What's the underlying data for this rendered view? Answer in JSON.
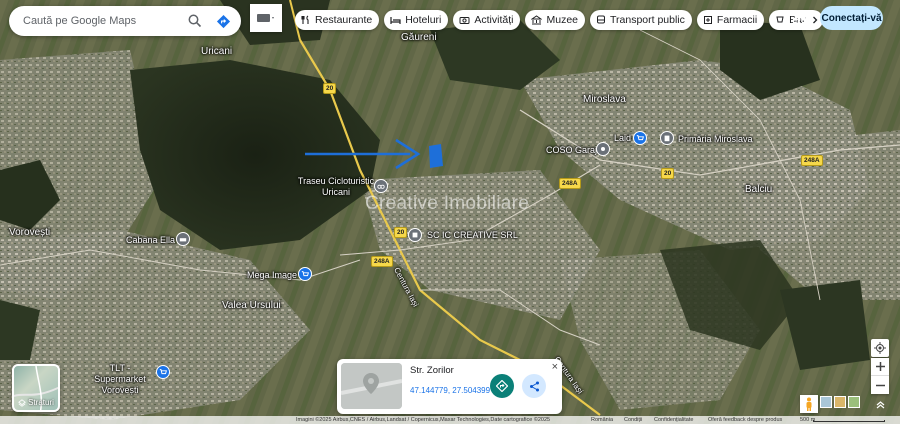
{
  "search": {
    "placeholder": "Caută pe Google Maps"
  },
  "chips": [
    {
      "label": "Restaurante",
      "icon": "fork-knife-icon"
    },
    {
      "label": "Hoteluri",
      "icon": "bed-icon"
    },
    {
      "label": "Activități",
      "icon": "camera-icon"
    },
    {
      "label": "Muzee",
      "icon": "museum-icon"
    },
    {
      "label": "Transport public",
      "icon": "bus-icon"
    },
    {
      "label": "Farmacii",
      "icon": "pharmacy-icon"
    },
    {
      "label": "Bar",
      "icon": "cup-icon"
    }
  ],
  "header": {
    "signin_label": "Conectați-vă"
  },
  "map_labels": {
    "gaureni": "Găureni",
    "uricani": "Uricani",
    "miroslava": "Miroslava",
    "laid": "Laid",
    "primaria": "Primăria Miroslava",
    "coso": "COSO Garaj",
    "traseu": "Traseu Cicloturistic Uricani",
    "balciu": "Balciu",
    "vorovesti": "Vorovești",
    "cabana": "Cabana Ella",
    "sc_creative": "SC IC CREATIVE SRL",
    "mega": "Mega Image",
    "valea": "Valea Ursului",
    "tlt": "TLT - Supermarket Vorovești",
    "centura1": "Centura Iași",
    "centura2": "Centura Iași"
  },
  "road_shields": {
    "r1": "20",
    "r2": "20",
    "r3": "20",
    "r4": "248A",
    "r5": "248A",
    "r6": "248A"
  },
  "watermark": "Creative Imobiliare",
  "layers": {
    "label": "Straturi"
  },
  "info_card": {
    "title": "Str. Zorilor",
    "coordinates": "47.144779, 27.504399",
    "close_symbol": "×"
  },
  "footer": {
    "attribution": "Imagini ©2025 Airbus,CNES / Airbus,Landsat / Copernicus,Maxar Technologies,Date cartografice ©2025",
    "country": "România",
    "terms": "Condiții",
    "privacy": "Confidențialitate",
    "feedback": "Oferă feedback despre produs",
    "scale": "500 m"
  },
  "colors": {
    "accent": "#1a73e8",
    "signin_bg": "#c2e7ff",
    "directions": "#0b8078",
    "arrow": "#1e6fd9"
  }
}
